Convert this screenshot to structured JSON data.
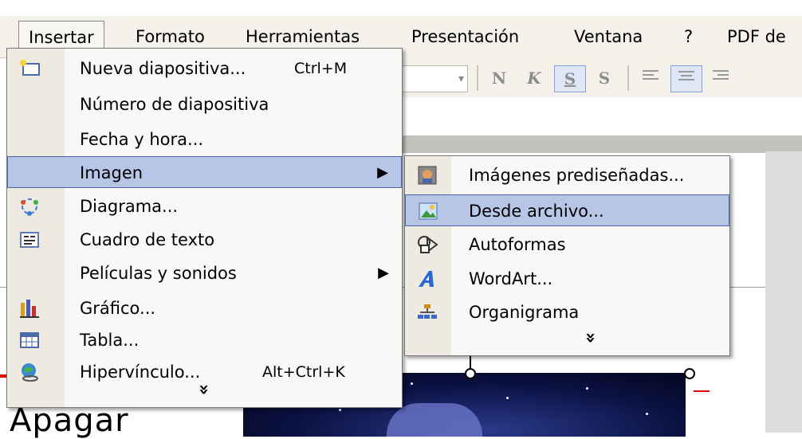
{
  "menubar": {
    "items": [
      {
        "label": "Insertar"
      },
      {
        "label": "Formato"
      },
      {
        "label": "Herramientas"
      },
      {
        "label": "Presentación"
      },
      {
        "label": "Ventana"
      },
      {
        "label": "?"
      },
      {
        "label": "PDF de"
      }
    ]
  },
  "toolbar": {
    "bold": "N",
    "italic": "K",
    "underline": "S",
    "shadow": "S"
  },
  "insert_menu": {
    "items": [
      {
        "label": "Nueva diapositiva...",
        "shortcut": "Ctrl+M",
        "icon": "new-slide-icon"
      },
      {
        "label": "Número de diapositiva"
      },
      {
        "label": "Fecha y hora..."
      },
      {
        "label": "Imagen",
        "submenu": true
      },
      {
        "label": "Diagrama...",
        "icon": "diagram-icon"
      },
      {
        "label": "Cuadro de texto",
        "icon": "textbox-icon"
      },
      {
        "label": "Películas y sonidos",
        "submenu": true
      },
      {
        "label": "Gráfico...",
        "icon": "chart-icon"
      },
      {
        "label": "Tabla...",
        "icon": "table-icon"
      },
      {
        "label": "Hipervínculo...",
        "shortcut": "Alt+Ctrl+K",
        "icon": "hyperlink-icon"
      }
    ],
    "expand_glyph": "»"
  },
  "image_submenu": {
    "items": [
      {
        "label": "Imágenes prediseñadas...",
        "icon": "clipart-icon"
      },
      {
        "label": "Desde archivo...",
        "icon": "from-file-icon"
      },
      {
        "label": "Autoformas",
        "icon": "autoshapes-icon"
      },
      {
        "label": "WordArt...",
        "icon": "wordart-icon"
      },
      {
        "label": "Organigrama",
        "icon": "org-chart-icon"
      }
    ],
    "expand_glyph": "»"
  },
  "slide": {
    "title_partial": "Apagar"
  },
  "colors": {
    "highlight": "#b7c6e6",
    "highlight_border": "#4e6aa8",
    "menubar_bg": "#f4f1ea"
  }
}
